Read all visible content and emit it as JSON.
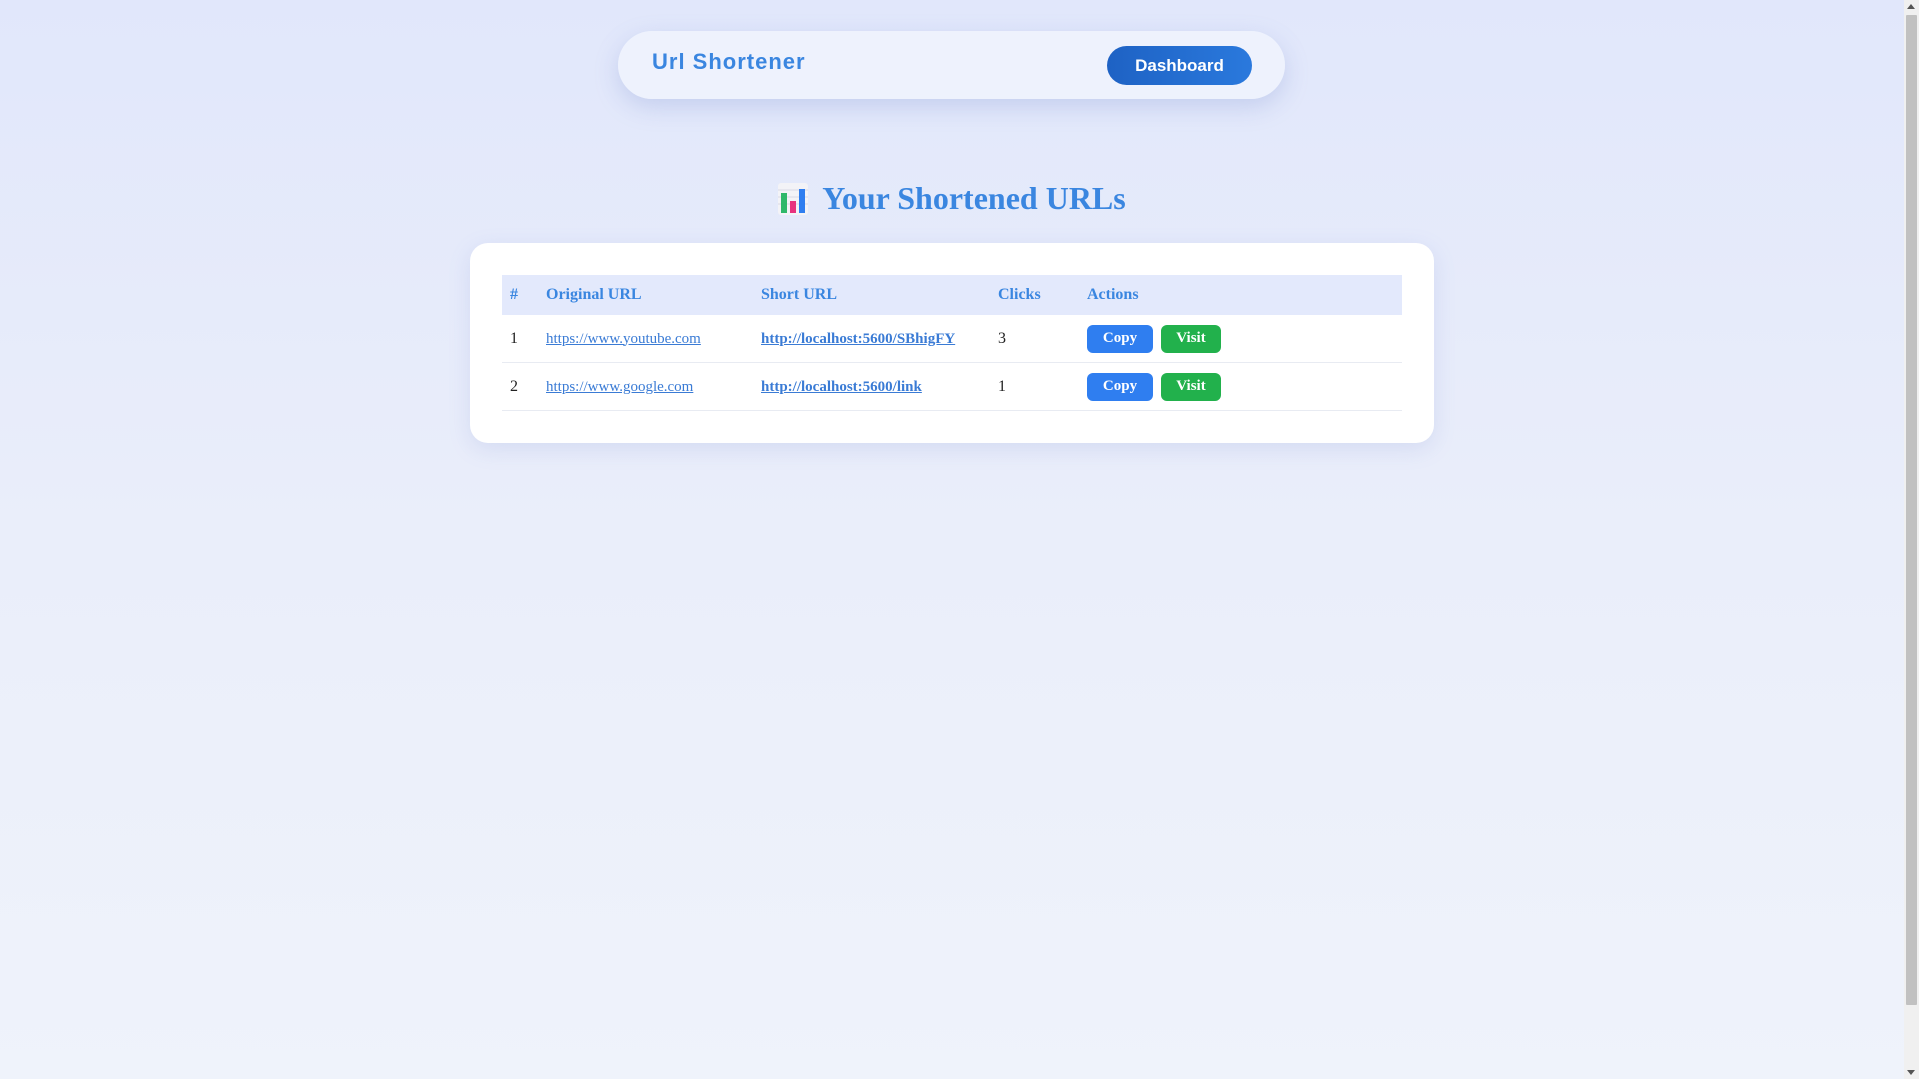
{
  "navbar": {
    "brand": "Url Shortener",
    "dashboard_label": "Dashboard"
  },
  "page": {
    "title_icon": "bar-chart-emoji",
    "title": "Your Shortened URLs"
  },
  "table": {
    "headers": [
      "#",
      "Original URL",
      "Short URL",
      "Clicks",
      "Actions"
    ],
    "rows": [
      {
        "index": "1",
        "original_url": "https://www.youtube.com",
        "short_url": "http://localhost:5600/SBhigFY",
        "clicks": "3",
        "copy_label": "Copy",
        "visit_label": "Visit"
      },
      {
        "index": "2",
        "original_url": "https://www.google.com",
        "short_url": "http://localhost:5600/link",
        "clicks": "1",
        "copy_label": "Copy",
        "visit_label": "Visit"
      }
    ]
  },
  "colors": {
    "accent": "#3a86e0",
    "dashboard_button": "#1e62c4",
    "copy_button": "#2f7ef0",
    "visit_button": "#22b14c",
    "table_header_bg": "#e3e9fc"
  }
}
